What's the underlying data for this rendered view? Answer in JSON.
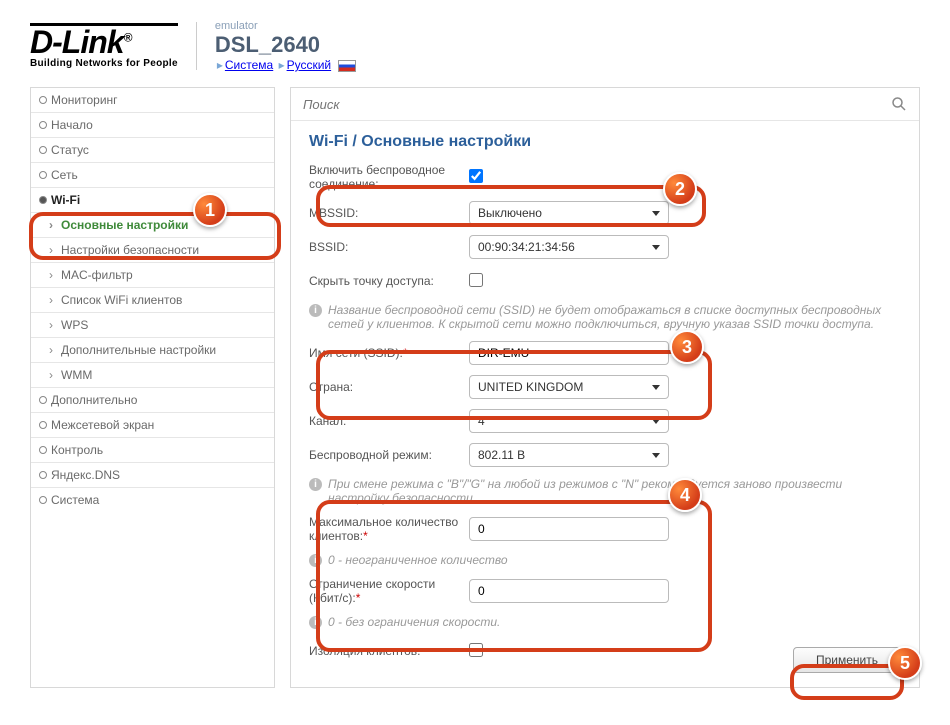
{
  "header": {
    "logo": "D-Link",
    "tagline": "Building Networks for People",
    "emulator": "emulator",
    "model": "DSL_2640",
    "crumb1": "Система",
    "crumb2": "Русский"
  },
  "search": {
    "placeholder": "Поиск"
  },
  "nav": {
    "items": [
      "Мониторинг",
      "Начало",
      "Статус",
      "Сеть",
      "Wi-Fi",
      "Дополнительно",
      "Межсетевой экран",
      "Контроль",
      "Яндекс.DNS",
      "Система"
    ],
    "wifi_sub": [
      "Основные настройки",
      "Настройки безопасности",
      "MAC-фильтр",
      "Список WiFi клиентов",
      "WPS",
      "Дополнительные настройки",
      "WMM"
    ]
  },
  "page_title": "Wi-Fi / Основные настройки",
  "fields": {
    "enable_label": "Включить беспроводное соединение:",
    "mbssid_label": "MBSSID:",
    "mbssid_value": "Выключено",
    "bssid_label": "BSSID:",
    "bssid_value": "00:90:34:21:34:56",
    "hide_ap_label": "Скрыть точку доступа:",
    "hide_ap_hint": "Название беспроводной сети (SSID) не будет отображаться в списке доступных беспроводных сетей у клиентов. К скрытой сети можно подключиться, вручную указав SSID точки доступа.",
    "ssid_label": "Имя сети (SSID):",
    "ssid_value": "DIR-EMU",
    "country_label": "Страна:",
    "country_value": "UNITED KINGDOM",
    "channel_label": "Канал:",
    "channel_value": "4",
    "mode_label": "Беспроводной режим:",
    "mode_value": "802.11 B",
    "mode_hint": "При смене режима с \"B\"/\"G\" на любой из режимов с \"N\" рекомендуется заново произвести настройку безопасности.",
    "max_clients_label": "Максимальное количество клиентов:",
    "max_clients_value": "0",
    "max_clients_hint": "0 - неограниченное количество",
    "speed_limit_label": "Ограничение скорости (Кбит/с):",
    "speed_limit_value": "0",
    "speed_limit_hint": "0 - без ограничения скорости.",
    "isolation_label": "Изоляция клиентов:"
  },
  "apply_label": "Применить",
  "badges": {
    "b1": "1",
    "b2": "2",
    "b3": "3",
    "b4": "4",
    "b5": "5"
  }
}
